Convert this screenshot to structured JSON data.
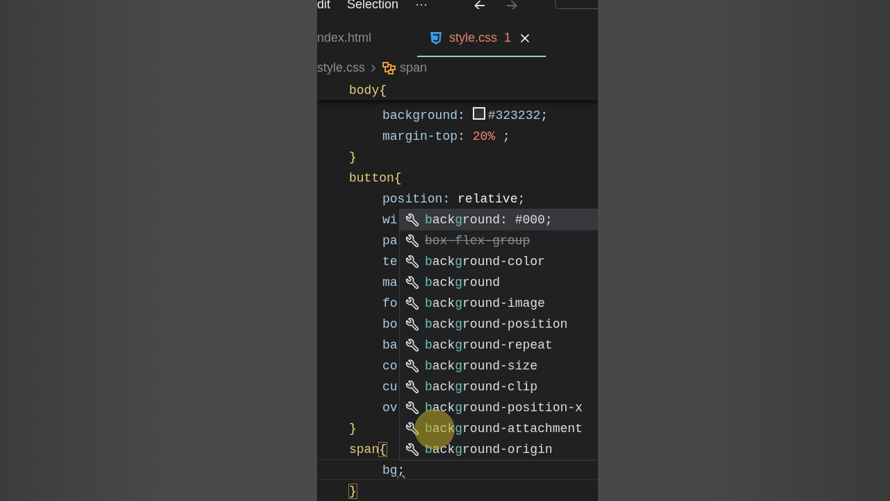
{
  "menu_bar": {
    "items": [
      "dit",
      "Selection",
      "···"
    ]
  },
  "tabs": [
    {
      "label": "ndex.html",
      "selected": false,
      "closable": false
    },
    {
      "label": "style.css",
      "selected": true,
      "problems": "1",
      "closable": true
    }
  ],
  "breadcrumb": [
    {
      "label": "style.css",
      "kind": "file"
    },
    {
      "label": "span",
      "kind": "symbol"
    }
  ],
  "sticky_line": {
    "kind": "rule_start",
    "tokens": [
      {
        "text": "body",
        "kind": "selector"
      },
      {
        "text": "{",
        "kind": "brace"
      }
    ]
  },
  "code_lines": [
    {
      "kind": "declaration",
      "current": false,
      "tokens": [
        {
          "text": "background",
          "kind": "property"
        },
        {
          "text": ": ",
          "kind": "punct"
        },
        {
          "text": "#323232",
          "kind": "color"
        },
        {
          "text": ";",
          "kind": "punct"
        }
      ]
    },
    {
      "kind": "declaration",
      "current": false,
      "tokens": [
        {
          "text": "margin-top",
          "kind": "property"
        },
        {
          "text": ": ",
          "kind": "punct"
        },
        {
          "text": "20%",
          "kind": "number"
        },
        {
          "text": " ;",
          "kind": "punct"
        }
      ]
    },
    {
      "kind": "rule_end",
      "current": false,
      "tokens": [
        {
          "text": "}",
          "kind": "brace"
        }
      ]
    },
    {
      "kind": "rule_start",
      "current": false,
      "tokens": [
        {
          "text": "button",
          "kind": "selector"
        },
        {
          "text": "{",
          "kind": "brace"
        }
      ]
    },
    {
      "kind": "declaration",
      "current": false,
      "tokens": [
        {
          "text": "position",
          "kind": "property"
        },
        {
          "text": ": ",
          "kind": "punct"
        },
        {
          "text": "relative",
          "kind": "value"
        },
        {
          "text": ";",
          "kind": "punct"
        }
      ]
    },
    {
      "kind": "declaration",
      "current": false,
      "tokens": [
        {
          "text": "wi",
          "kind": "property"
        }
      ]
    },
    {
      "kind": "declaration",
      "current": false,
      "tokens": [
        {
          "text": "pa",
          "kind": "property"
        }
      ]
    },
    {
      "kind": "declaration",
      "current": false,
      "tokens": [
        {
          "text": "te",
          "kind": "property"
        }
      ]
    },
    {
      "kind": "declaration",
      "current": false,
      "tokens": [
        {
          "text": "ma",
          "kind": "property"
        }
      ]
    },
    {
      "kind": "declaration",
      "current": false,
      "tokens": [
        {
          "text": "fo",
          "kind": "property"
        }
      ]
    },
    {
      "kind": "declaration",
      "current": false,
      "tokens": [
        {
          "text": "bo",
          "kind": "property"
        }
      ]
    },
    {
      "kind": "declaration",
      "current": false,
      "tokens": [
        {
          "text": "ba",
          "kind": "property"
        }
      ]
    },
    {
      "kind": "declaration",
      "current": false,
      "tokens": [
        {
          "text": "co",
          "kind": "property"
        }
      ]
    },
    {
      "kind": "declaration",
      "current": false,
      "tokens": [
        {
          "text": "cu",
          "kind": "property"
        }
      ]
    },
    {
      "kind": "declaration",
      "current": false,
      "tokens": [
        {
          "text": "ov",
          "kind": "property"
        }
      ]
    },
    {
      "kind": "rule_end",
      "current": false,
      "tokens": [
        {
          "text": "}",
          "kind": "brace"
        }
      ]
    },
    {
      "kind": "rule_start",
      "current": false,
      "tokens": [
        {
          "text": "span",
          "kind": "selector"
        },
        {
          "text": "{",
          "kind": "bracket_match"
        }
      ]
    },
    {
      "kind": "declaration",
      "current": true,
      "tokens": [
        {
          "text": "bg",
          "kind": "property"
        },
        {
          "text": ";",
          "kind": "error"
        }
      ]
    },
    {
      "kind": "rule_end",
      "current": false,
      "tokens": [
        {
          "text": "}",
          "kind": "bracket_match"
        }
      ]
    }
  ],
  "suggestions": [
    {
      "label": "**b**ack**g**round: #000;",
      "selected": true,
      "deprecated": false
    },
    {
      "label": "box-flex-group",
      "selected": false,
      "deprecated": true
    },
    {
      "label": "**b**ack**g**round-color",
      "selected": false,
      "deprecated": false
    },
    {
      "label": "**b**ack**g**round",
      "selected": false,
      "deprecated": false
    },
    {
      "label": "**b**ack**g**round-image",
      "selected": false,
      "deprecated": false
    },
    {
      "label": "**b**ack**g**round-position",
      "selected": false,
      "deprecated": false
    },
    {
      "label": "**b**ack**g**round-repeat",
      "selected": false,
      "deprecated": false
    },
    {
      "label": "**b**ack**g**round-size",
      "selected": false,
      "deprecated": false
    },
    {
      "label": "**b**ack**g**round-clip",
      "selected": false,
      "deprecated": false
    },
    {
      "label": "**b**ack**g**round-position-x",
      "selected": false,
      "deprecated": false
    },
    {
      "label": "**b**ack**g**round-attachment",
      "selected": false,
      "deprecated": false
    },
    {
      "label": "**b**ack**g**round-origin",
      "selected": false,
      "deprecated": false
    }
  ]
}
